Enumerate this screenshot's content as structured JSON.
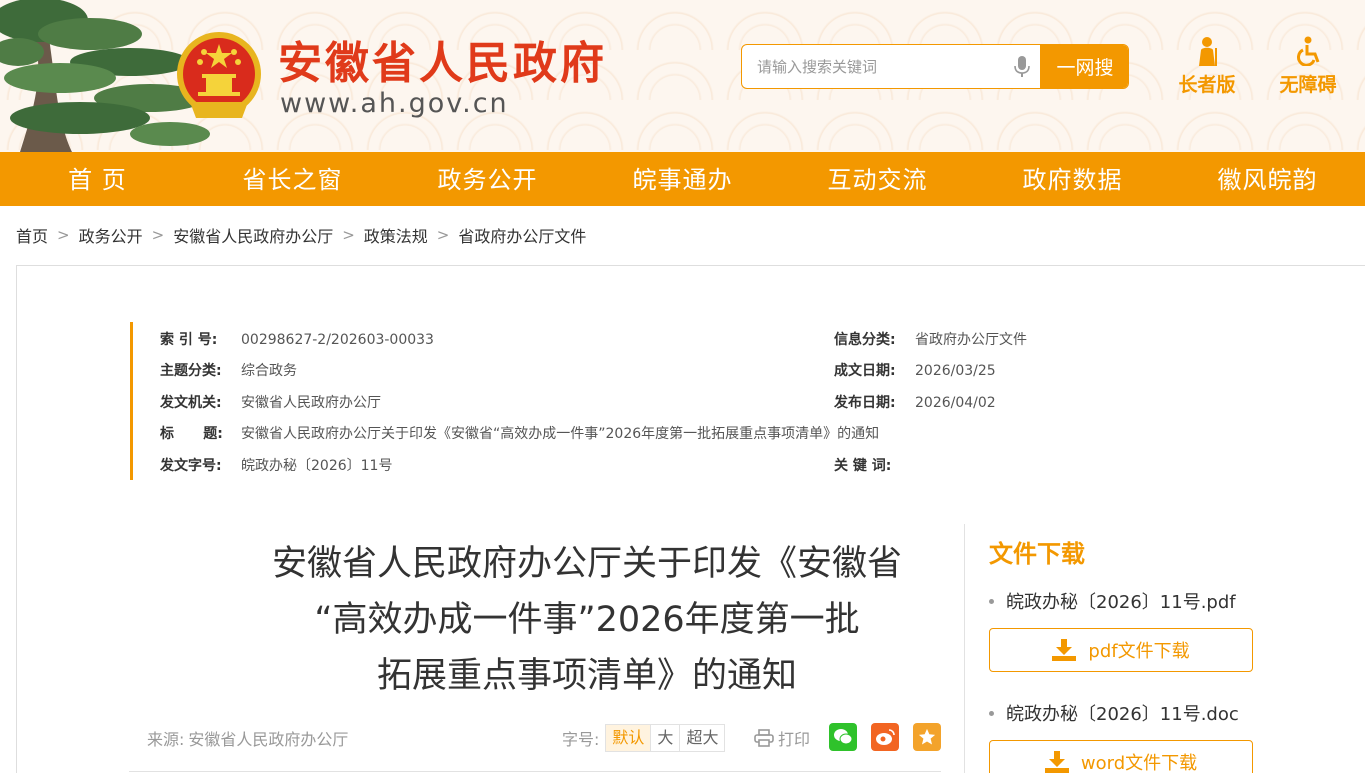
{
  "header": {
    "site_title": "安徽省人民政府",
    "site_url": "www.ah.gov.cn",
    "search_placeholder": "请输入搜索关键词",
    "search_button": "一网搜",
    "elder_mode": "长者版",
    "accessible_mode": "无障碍"
  },
  "nav": {
    "items": [
      "首 页",
      "省长之窗",
      "政务公开",
      "皖事通办",
      "互动交流",
      "政府数据",
      "徽风皖韵"
    ]
  },
  "breadcrumb": {
    "items": [
      "首页",
      "政务公开",
      "安徽省人民政府办公厅",
      "政策法规",
      "省政府办公厅文件"
    ],
    "separator": ">"
  },
  "meta": {
    "index_label": "索 引 号:",
    "index_value": "00298627-2/202603-00033",
    "category_label": "信息分类:",
    "category_value": "省政府办公厅文件",
    "theme_label": "主题分类:",
    "theme_value": "综合政务",
    "created_label": "成文日期:",
    "created_value": "2026/03/25",
    "issuer_label": "发文机关:",
    "issuer_value": "安徽省人民政府办公厅",
    "published_label": "发布日期:",
    "published_value": "2026/04/02",
    "title_label": "标      题:",
    "title_value": "安徽省人民政府办公厅关于印发《安徽省“高效办成一件事”2026年度第一批拓展重点事项清单》的通知",
    "docno_label": "发文字号:",
    "docno_value": "皖政办秘〔2026〕11号",
    "keywords_label": "关 键 词:",
    "keywords_value": ""
  },
  "article": {
    "title_line1": "安徽省人民政府办公厅关于印发《安徽省",
    "title_line2": "“高效办成一件事”2026年度第一批",
    "title_line3": "拓展重点事项清单》的通知",
    "source_label": "来源:",
    "source_value": "安徽省人民政府办公厅",
    "fontsize_label": "字号:",
    "fontsize_options": [
      "默认",
      "大",
      "超大"
    ],
    "print_label": "打印"
  },
  "downloads": {
    "title": "文件下载",
    "files": [
      {
        "name": "皖政办秘〔2026〕11号.pdf",
        "button": "pdf文件下载"
      },
      {
        "name": "皖政办秘〔2026〕11号.doc",
        "button": "word文件下载"
      }
    ]
  },
  "colors": {
    "accent": "#f39800",
    "brand_red": "#e03a1a",
    "wechat": "#2fc22b",
    "weibo": "#f26522",
    "favorite": "#f3a32b"
  }
}
